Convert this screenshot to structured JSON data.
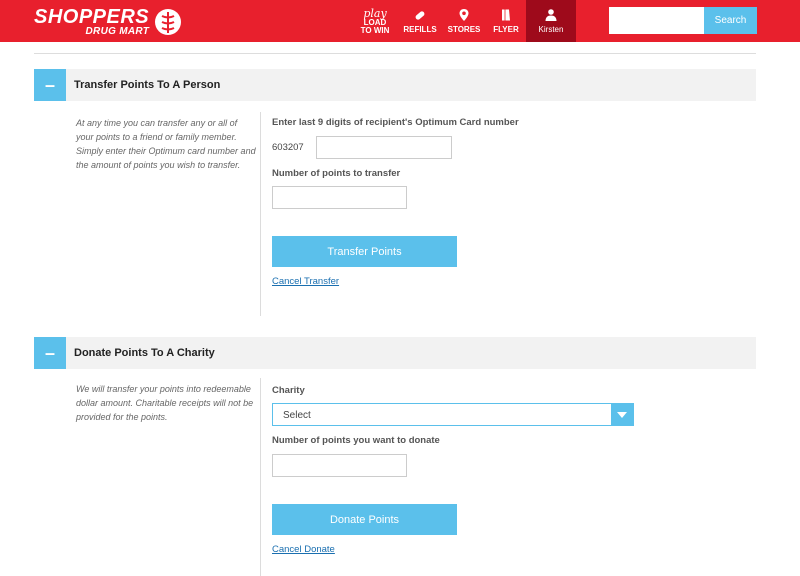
{
  "header": {
    "logo_line1": "SHOPPERS",
    "logo_line2": "DRUG MART",
    "brand_color": "#e8202d",
    "accent_color": "#5bc0eb",
    "nav": {
      "play_label": "play",
      "load_label": "LOAD",
      "to_win_label": "TO WIN",
      "refills_label": "REFILLS",
      "stores_label": "STORES",
      "flyer_label": "FLYER",
      "user_label": "Kirsten"
    },
    "search": {
      "value": "",
      "placeholder": "",
      "button_label": "Search"
    }
  },
  "transfer": {
    "title": "Transfer Points To A Person",
    "toggle": "–",
    "description": "At any time you can transfer any or all of your points to a friend or family member. Simply enter their Optimum card number and the amount of points you wish to transfer.",
    "card_label": "Enter last 9 digits of recipient's Optimum Card number",
    "card_prefix": "603207",
    "card_value": "",
    "points_label": "Number of points to transfer",
    "points_value": "",
    "submit_label": "Transfer Points",
    "cancel_label": "Cancel Transfer"
  },
  "donate": {
    "title": "Donate Points To A Charity",
    "toggle": "–",
    "description": "We will transfer your points into redeemable dollar amount. Charitable receipts will not be provided for the points.",
    "charity_label": "Charity",
    "charity_selected": "Select",
    "points_label": "Number of points you want to donate",
    "points_value": "",
    "submit_label": "Donate Points",
    "cancel_label": "Cancel Donate"
  }
}
